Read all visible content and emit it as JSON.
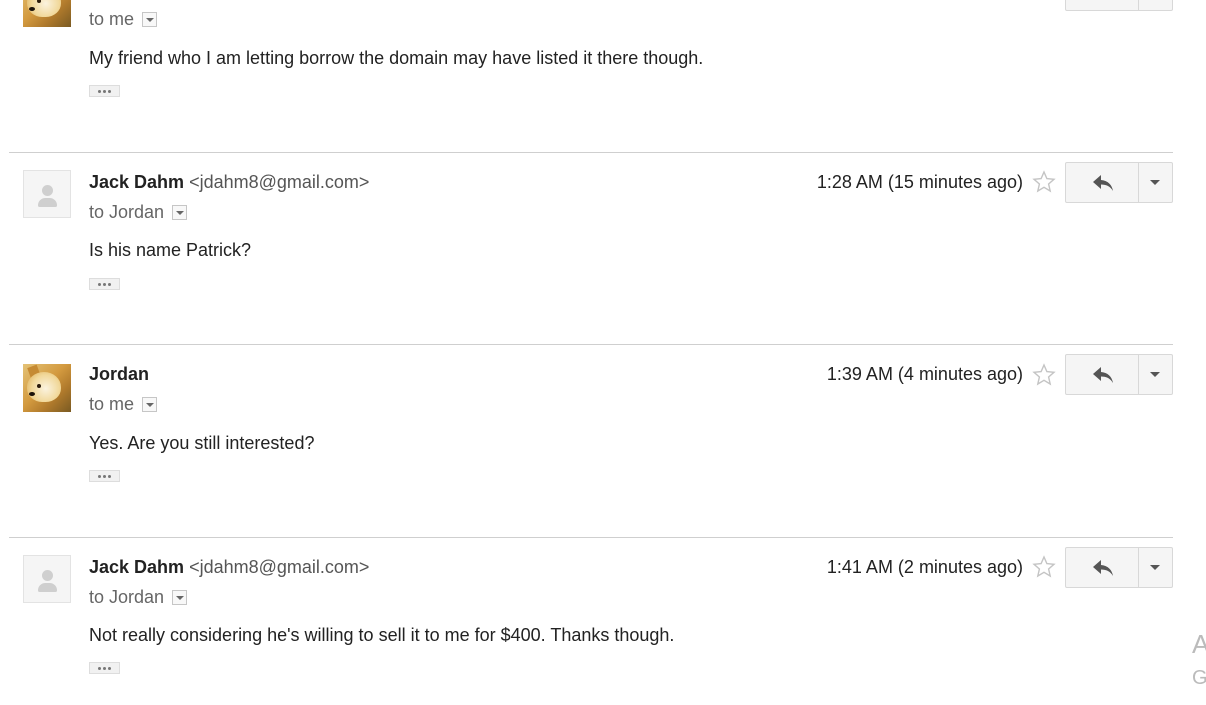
{
  "messages": [
    {
      "sender_name": "",
      "sender_email": "",
      "recipient": "to me",
      "timestamp": "",
      "body": "My friend who I am letting borrow the domain may have listed it there though.",
      "avatar": "doge-avatar"
    },
    {
      "sender_name": "Jack Dahm",
      "sender_email": "<jdahm8@gmail.com>",
      "recipient": "to Jordan",
      "timestamp": "1:28 AM (15 minutes ago)",
      "body": "Is his name Patrick?",
      "avatar": "generic-avatar"
    },
    {
      "sender_name": "Jordan",
      "sender_email": "",
      "recipient": "to me",
      "timestamp": "1:39 AM (4 minutes ago)",
      "body": "Yes. Are you still interested?",
      "avatar": "doge-avatar"
    },
    {
      "sender_name": "Jack Dahm",
      "sender_email": "<jdahm8@gmail.com>",
      "recipient": "to Jordan",
      "timestamp": "1:41 AM (2 minutes ago)",
      "body": "Not really considering he's willing to sell it to me for $400. Thanks though.",
      "avatar": "generic-avatar"
    }
  ],
  "side_fragments": {
    "top": "A",
    "bottom": "G"
  },
  "icons": {
    "star": "star-outline-icon",
    "reply": "reply-arrow-icon",
    "more": "chevron-down-icon",
    "quoted": "ellipsis-icon"
  },
  "colors": {
    "text": "#222222",
    "muted": "#666666",
    "divider": "#cfcfcf",
    "button_bg": "#f5f5f5"
  }
}
